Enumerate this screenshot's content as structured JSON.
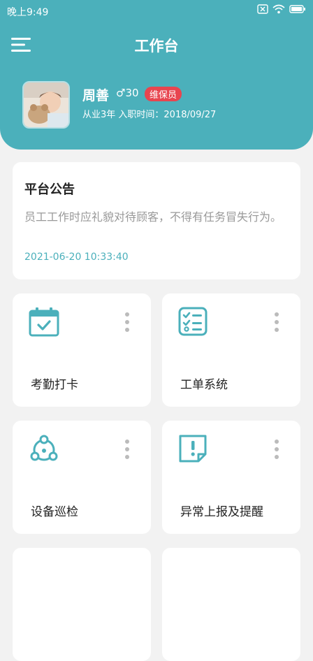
{
  "status_bar": {
    "time": "晚上9:49"
  },
  "header": {
    "title": "工作台"
  },
  "profile": {
    "name": "周善",
    "gender_age": "♂30",
    "role": "维保员",
    "details": "从业3年  入职时间：2018/09/27"
  },
  "notice": {
    "title": "平台公告",
    "content": "员工工作时应礼貌对待顾客，不得有任务冒失行为。",
    "time": "2021-06-20 10:33:40"
  },
  "modules": [
    {
      "label": "考勤打卡",
      "icon": "calendar-check-icon"
    },
    {
      "label": "工单系统",
      "icon": "checklist-icon"
    },
    {
      "label": "设备巡检",
      "icon": "network-icon"
    },
    {
      "label": "异常上报及提醒",
      "icon": "alert-note-icon"
    }
  ],
  "colors": {
    "accent": "#4bb0bb",
    "badge": "#e8454f"
  }
}
